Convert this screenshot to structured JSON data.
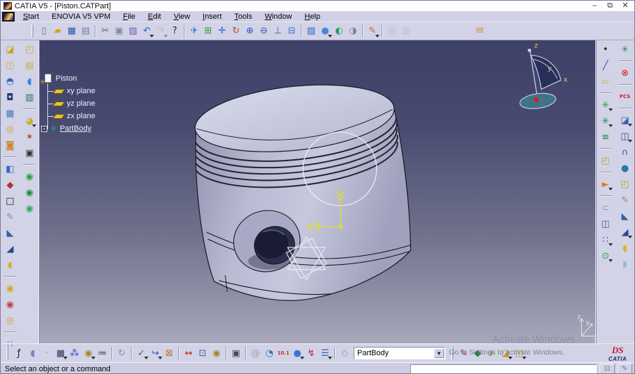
{
  "window": {
    "title": "CATIA V5 - [Piston.CATPart]",
    "controls": {
      "minimize": "–",
      "restore": "⧉",
      "close": "✕"
    }
  },
  "menubar": {
    "items": [
      {
        "name": "menu-start",
        "label": "Start",
        "u": 0
      },
      {
        "name": "menu-enovia",
        "label": "ENOVIA V5 VPM",
        "u": -1
      },
      {
        "name": "menu-file",
        "label": "File",
        "u": 0
      },
      {
        "name": "menu-edit",
        "label": "Edit",
        "u": 0
      },
      {
        "name": "menu-view",
        "label": "View",
        "u": 0
      },
      {
        "name": "menu-insert",
        "label": "Insert",
        "u": 0
      },
      {
        "name": "menu-tools",
        "label": "Tools",
        "u": 0
      },
      {
        "name": "menu-window",
        "label": "Window",
        "u": 0
      },
      {
        "name": "menu-help",
        "label": "Help",
        "u": 0
      }
    ]
  },
  "toolbar_top": {
    "icons": [
      {
        "name": "new-file-icon",
        "g": "▯",
        "fg": "#70708a"
      },
      {
        "name": "open-folder-icon",
        "g": "▰",
        "fg": "#d8a018"
      },
      {
        "name": "save-icon",
        "g": "▦",
        "fg": "#2456b8"
      },
      {
        "name": "print-icon",
        "g": "▤",
        "fg": "#7080a8"
      },
      {
        "sep": true
      },
      {
        "name": "cut-icon",
        "g": "✂",
        "fg": "#606070"
      },
      {
        "name": "copy-icon",
        "g": "▣",
        "fg": "#8088a8"
      },
      {
        "name": "paste-icon",
        "g": "▨",
        "fg": "#7858b8"
      },
      {
        "name": "undo-icon",
        "g": "↶",
        "fg": "#2858c0",
        "dd": true
      },
      {
        "name": "redo-icon",
        "g": "↷",
        "fg": "#9a9ab0",
        "dd": true,
        "dis": true
      },
      {
        "name": "whats-this-icon",
        "g": "?",
        "fg": "#202020"
      },
      {
        "sep": true
      },
      {
        "name": "fly-mode-icon",
        "g": "✈",
        "fg": "#2878d8"
      },
      {
        "name": "fit-all-in-icon",
        "g": "⊞",
        "fg": "#28a038"
      },
      {
        "name": "pan-icon",
        "g": "✛",
        "fg": "#2858c0"
      },
      {
        "name": "rotate-icon",
        "g": "↻",
        "fg": "#c84818"
      },
      {
        "name": "zoom-in-icon",
        "g": "⊕",
        "fg": "#2858c0"
      },
      {
        "name": "zoom-out-icon",
        "g": "⊖",
        "fg": "#2858c0"
      },
      {
        "name": "normal-view-icon",
        "g": "⊥",
        "fg": "#2858c0"
      },
      {
        "name": "multi-view-icon",
        "g": "⊟",
        "fg": "#2878d8"
      },
      {
        "sep": true
      },
      {
        "name": "iso-view-icon",
        "g": "▧",
        "fg": "#2868c8"
      },
      {
        "name": "shading-mode-icon",
        "g": "●",
        "fg": "#4888d8",
        "dd": true
      },
      {
        "name": "hide-show-icon",
        "g": "◐",
        "fg": "#28a060"
      },
      {
        "name": "swap-visible-space-icon",
        "g": "◑",
        "fg": "#7888a0"
      },
      {
        "sep": true
      },
      {
        "name": "sketcher-icon",
        "g": "✎",
        "fg": "#d06818",
        "dd": true
      },
      {
        "sep": true
      },
      {
        "name": "catalog-icon",
        "g": "▥",
        "fg": "#a8a8b8",
        "dis": true
      },
      {
        "name": "part-catalog-icon",
        "g": "▥",
        "fg": "#90a8c8",
        "dis": true
      },
      {
        "gap": true
      },
      {
        "name": "send-mail-icon",
        "g": "✉",
        "fg": "#c89020"
      }
    ]
  },
  "sidebar_left": {
    "col_a": [
      {
        "name": "pad-icon",
        "g": "◪",
        "fg": "#d0a028"
      },
      {
        "name": "pocket-icon",
        "g": "◫",
        "fg": "#c8b048"
      },
      {
        "name": "shaft-icon",
        "g": "◓",
        "fg": "#3068b8"
      },
      {
        "name": "groove-icon",
        "g": "◘",
        "fg": "#28387a"
      },
      {
        "name": "multi-pad-icon",
        "g": "▦",
        "fg": "#4878c0"
      },
      {
        "name": "hole-icon",
        "g": "◎",
        "fg": "#c8a020"
      },
      {
        "name": "rib-icon",
        "g": "◙",
        "fg": "#d08828"
      },
      {
        "sep": true
      },
      {
        "name": "surface-icon",
        "g": "◧",
        "fg": "#3868c0"
      },
      {
        "name": "transform-icon",
        "g": "◆",
        "fg": "#b83030"
      },
      {
        "name": "frame-icon",
        "g": "□",
        "fg": "#202020"
      },
      {
        "name": "annotation-icon",
        "g": "✎",
        "fg": "#8a8a98"
      },
      {
        "name": "chamfer-icon",
        "g": "◣",
        "fg": "#3060a8"
      },
      {
        "name": "draft-angle-icon",
        "g": "◢",
        "fg": "#284888"
      },
      {
        "name": "shell-icon",
        "g": "◖",
        "fg": "#d8b030"
      },
      {
        "sep": true
      },
      {
        "name": "assemble-boolean-icon",
        "g": "◉",
        "fg": "#d0a828"
      },
      {
        "name": "remove-boolean-icon",
        "g": "◉",
        "fg": "#c04040"
      },
      {
        "name": "union-trim-icon",
        "g": "◎",
        "fg": "#c8a040"
      },
      {
        "sep": true
      },
      {
        "name": "points-icon",
        "g": "∷",
        "fg": "#5878a0"
      }
    ],
    "col_b": [
      {
        "name": "open-body-icon",
        "g": "◰",
        "fg": "#d8a828"
      },
      {
        "name": "stacked-sheets-icon",
        "g": "▤",
        "fg": "#c8b040"
      },
      {
        "name": "eraser-icon",
        "g": "◖",
        "fg": "#3888d8"
      },
      {
        "name": "catalog-book-icon",
        "g": "▥",
        "fg": "#286858"
      },
      {
        "sep": true
      },
      {
        "name": "material-sphere-icon",
        "g": "◕",
        "fg": "#c8b030",
        "dd": true
      },
      {
        "name": "paint-splash-icon",
        "g": "✶",
        "fg": "#c04040"
      },
      {
        "name": "dark-box-icon",
        "g": "▣",
        "fg": "#343434"
      },
      {
        "sep": true
      },
      {
        "name": "render-select-icon",
        "g": "◉",
        "fg": "#28a048"
      },
      {
        "name": "render-remove-icon",
        "g": "◉",
        "fg": "#208840"
      },
      {
        "name": "render-move-icon",
        "g": "◉",
        "fg": "#30a858"
      }
    ]
  },
  "sidebar_right": {
    "col_inner": [
      {
        "name": "point-icon",
        "g": "•",
        "fg": "#282828"
      },
      {
        "name": "line-icon",
        "g": "╱",
        "fg": "#2858c0"
      },
      {
        "name": "plane-icon",
        "g": "▱",
        "fg": "#d8b030"
      },
      {
        "sep": true
      },
      {
        "name": "geometrical-set-icon",
        "g": "✳",
        "fg": "#28a040",
        "dd": true
      },
      {
        "name": "ordered-set-icon",
        "g": "✳",
        "fg": "#208858",
        "dd": true
      },
      {
        "name": "tree-structure-icon",
        "g": "≡",
        "fg": "#208048"
      },
      {
        "sep": true
      },
      {
        "name": "open-box-icon",
        "g": "◰",
        "fg": "#c8a030"
      },
      {
        "sep": true
      },
      {
        "name": "select-cursor-icon",
        "g": "►",
        "fg": "#e07818",
        "dd": true
      },
      {
        "sep": true
      },
      {
        "name": "attach-icon",
        "g": "⊂",
        "fg": "#8898b0"
      },
      {
        "name": "mirror-icon",
        "g": "◫",
        "fg": "#3060b8"
      },
      {
        "name": "pattern-icon",
        "g": "∷",
        "fg": "#3048a0",
        "dd": true
      },
      {
        "name": "scaling-icon",
        "g": "⊙",
        "fg": "#28a040",
        "dd": true
      }
    ],
    "col_outer": [
      {
        "name": "gear-flag-icon",
        "g": "✳",
        "fg": "#288858"
      },
      {
        "sep": true
      },
      {
        "name": "close-workbench-icon",
        "g": "⊗",
        "fg": "#d81818"
      },
      {
        "sep": true
      },
      {
        "name": "pcs-icon",
        "g": "PCS",
        "fg": "#c02020",
        "sm": true
      },
      {
        "sep": true
      },
      {
        "name": "pad-alt-icon",
        "g": "◪",
        "fg": "#3060b8",
        "dd": true
      },
      {
        "name": "pocket-alt-icon",
        "g": "◫",
        "fg": "#3048a0",
        "dd": true
      },
      {
        "name": "multi-sections-icon",
        "g": "∩",
        "fg": "#3058b0"
      },
      {
        "name": "cylinder-cut-icon",
        "g": "●",
        "fg": "#2878a8"
      },
      {
        "name": "open-body-alt-icon",
        "g": "◰",
        "fg": "#c8a030"
      },
      {
        "name": "sketch-flat-icon",
        "g": "✎",
        "fg": "#8a8a98"
      },
      {
        "name": "chamfer-alt-icon",
        "g": "◣",
        "fg": "#3060a8"
      },
      {
        "name": "draft-alt-icon",
        "g": "◢",
        "fg": "#284888",
        "dd": true
      },
      {
        "name": "shell-alt-icon",
        "g": "◖",
        "fg": "#d8b030"
      },
      {
        "name": "thickness-icon",
        "g": "◗",
        "fg": "#90b8d8"
      }
    ]
  },
  "toolbar_bottom": {
    "icons_left": [
      {
        "name": "formula-fx-icon",
        "g": "ƒ",
        "fg": "#202020"
      },
      {
        "name": "comment-bubble-icon",
        "g": "◖",
        "fg": "#8878c0"
      },
      {
        "name": "knowledge-icon",
        "g": "·",
        "fg": "#888898"
      },
      {
        "name": "design-table-icon",
        "g": "▦",
        "fg": "#283858",
        "dd": true
      },
      {
        "name": "relations-icon",
        "g": "⁂",
        "fg": "#2848c0"
      },
      {
        "name": "lock-icon",
        "g": "◉",
        "fg": "#a08828",
        "dd": true
      },
      {
        "name": "check-equation-icon",
        "g": "≔",
        "fg": "#283838"
      },
      {
        "sep": true
      },
      {
        "name": "turntable-icon",
        "g": "↻",
        "fg": "#8890a8"
      },
      {
        "sep": true
      },
      {
        "name": "spellcheck-icon",
        "g": "✓",
        "fg": "#288028",
        "dd": true
      },
      {
        "name": "link-annotation-icon",
        "g": "↪",
        "fg": "#2858c0",
        "dd": true
      },
      {
        "name": "mailbox-icon",
        "g": "⊠",
        "fg": "#c07828"
      },
      {
        "sep": true
      },
      {
        "name": "measure-between-icon",
        "g": "↔",
        "fg": "#c02020"
      },
      {
        "name": "measure-item-icon",
        "g": "⊡",
        "fg": "#3860b0"
      },
      {
        "name": "mass-properties-icon",
        "g": "◉",
        "fg": "#a88020"
      },
      {
        "sep": true
      },
      {
        "name": "camera-capture-icon",
        "g": "▣",
        "fg": "#484858"
      },
      {
        "sep": true
      },
      {
        "name": "swirl-update-icon",
        "g": "@",
        "fg": "#98a0b0"
      },
      {
        "name": "globe-nav-icon",
        "g": "◔",
        "fg": "#2878b8"
      },
      {
        "name": "dimension-values-icon",
        "g": "10.1",
        "fg": "#c03030",
        "sm": true
      },
      {
        "name": "part-cylinder-icon",
        "g": "●",
        "fg": "#3878d0",
        "dd": true
      },
      {
        "name": "update-bolt-icon",
        "g": "↯",
        "fg": "#c02020"
      },
      {
        "name": "levels-icon",
        "g": "☰",
        "fg": "#3060c0",
        "dd": true
      },
      {
        "sep": true
      },
      {
        "name": "wireframe-diamond-icon",
        "g": "◇",
        "fg": "#8890c8"
      }
    ],
    "combo": {
      "value": "PartBody",
      "arrow": "▼"
    },
    "icons_right": [
      {
        "name": "paint-brush-icon",
        "g": "✎",
        "fg": "#c04040"
      },
      {
        "name": "map-catalog-icon",
        "g": "◆",
        "fg": "#288048"
      },
      {
        "name": "gear-clock-icon",
        "g": "✳",
        "fg": "#b08820"
      },
      {
        "name": "folder-pen-icon",
        "g": "◪",
        "fg": "#c8a030",
        "dd": true
      },
      {
        "name": "folder-send-icon",
        "g": "◫",
        "fg": "#c8a030",
        "dd": true
      }
    ],
    "brand": {
      "swoosh": "DS",
      "word": "CATIA"
    }
  },
  "tree": {
    "root": "Piston",
    "root_icon_glyph": "✳",
    "expand_glyph": "+",
    "partbody_gear_glyph": "✳",
    "planes": [
      {
        "name": "tree-node-xy-plane",
        "label": "xy plane"
      },
      {
        "name": "tree-node-yz-plane",
        "label": "yz plane"
      },
      {
        "name": "tree-node-zx-plane",
        "label": "zx plane"
      }
    ],
    "partbody": "PartBody"
  },
  "viewport": {
    "compass": {
      "x": "x",
      "y": "y",
      "z": "z"
    },
    "triad": {
      "x": "x",
      "y": "y",
      "z": "z"
    },
    "watermark": {
      "line1": "Activate Windows",
      "line2": "Go to Settings to activate Windows."
    }
  },
  "statusbar": {
    "message": "Select an object or a command",
    "input_value": "",
    "buttons": [
      {
        "name": "power-input-expand-button",
        "g": "⊡"
      },
      {
        "name": "doc-help-button",
        "g": "✎"
      }
    ]
  },
  "colors": {
    "chrome": "#d2d3e6",
    "viewport_top": "#3d4067",
    "viewport_bottom": "#a7a8ba",
    "piston_body": "#b9bbd3",
    "highlight_yellow": "#dede2a",
    "tree_text": "#eeeeff"
  }
}
